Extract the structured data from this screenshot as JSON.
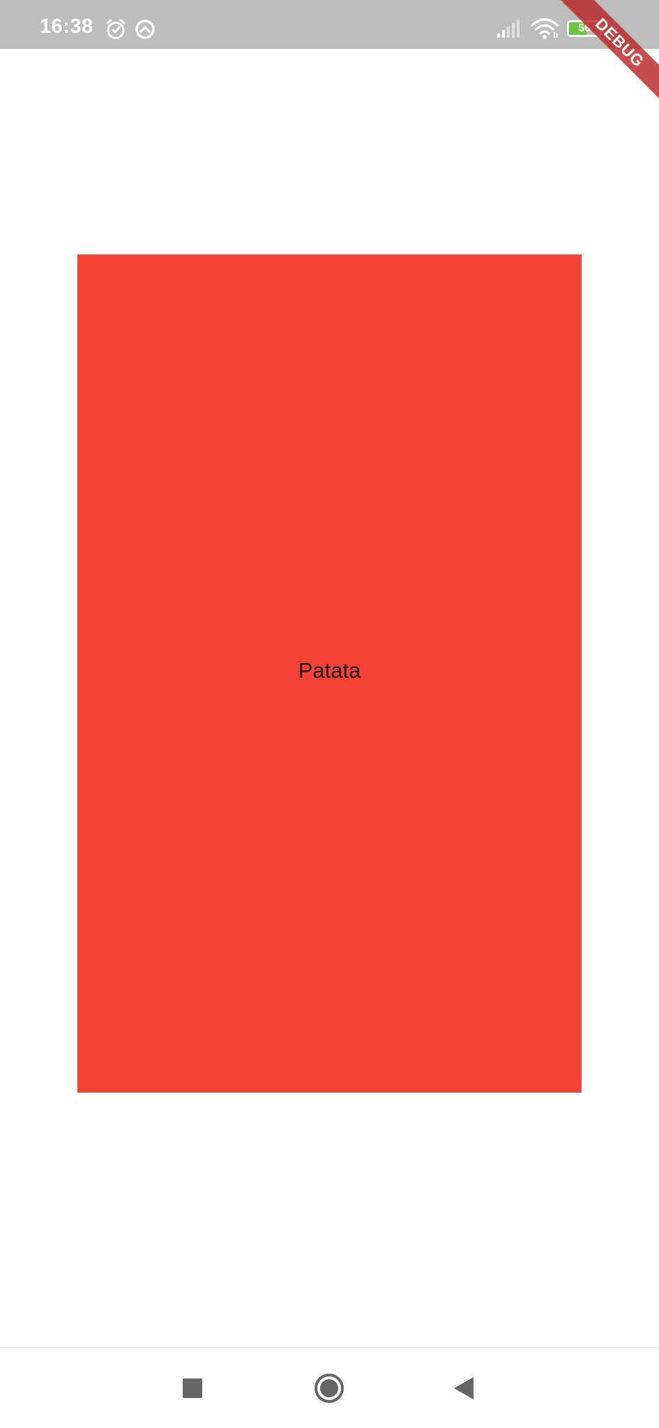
{
  "status_bar": {
    "time": "16:38",
    "icons": [
      "alarm-icon",
      "data-saver-icon",
      "signal-icon",
      "wifi-icon",
      "battery-icon",
      "charging-icon"
    ],
    "battery_level": "56",
    "battery_fraction": 0.56,
    "battery_color": "#6cc644",
    "background_color": "#bdbdbd"
  },
  "debug_banner": {
    "label": "DEBUG"
  },
  "main": {
    "box_label": "Patata",
    "box_color": "#f44336",
    "background_color": "#ffffff"
  },
  "nav_bar": {
    "buttons": [
      "recents-icon",
      "home-icon",
      "back-icon"
    ]
  }
}
